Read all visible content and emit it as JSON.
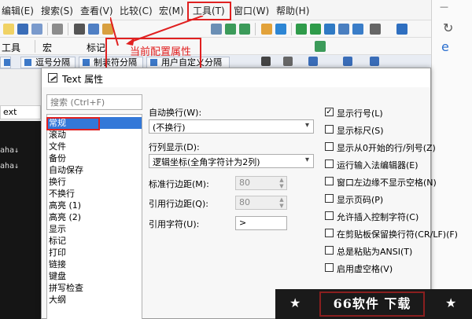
{
  "menu": {
    "items": [
      "编辑(E)",
      "搜索(S)",
      "查看(V)",
      "比较(C)",
      "宏(M)",
      "工具(T)",
      "窗口(W)",
      "帮助(H)"
    ],
    "highlighted": "工具(T)"
  },
  "toolbar2": {
    "tools_label": "工具",
    "macro_label": "宏",
    "mark_label": "标记"
  },
  "tabs": [
    "逗号分隔",
    "制表符分隔",
    "用户自定义分隔"
  ],
  "left_panel": {
    "tab_label": "ext",
    "lines": [
      "aha↓",
      "aha↓"
    ]
  },
  "annotation": {
    "label": "当前配置属性",
    "color": "#e02020"
  },
  "dialog": {
    "title": "Text 属性",
    "search_placeholder": "搜索 (Ctrl+F)",
    "categories": [
      "常规",
      "滚动",
      "文件",
      "备份",
      "自动保存",
      "换行",
      "不换行",
      "高亮 (1)",
      "高亮 (2)",
      "显示",
      "标记",
      "打印",
      "链接",
      "键盘",
      "拼写检查",
      "大纲"
    ],
    "selected_category": "常规",
    "auto_wrap": {
      "label": "自动换行(W):",
      "value": "(不换行)"
    },
    "column_display": {
      "label": "行列显示(D):",
      "value": "逻辑坐标(全角字符计为2列)"
    },
    "std_margin": {
      "label": "标准行边距(M):",
      "value": "80"
    },
    "quote_margin": {
      "label": "引用行边距(Q):",
      "value": "80"
    },
    "quote_char": {
      "label": "引用字符(U):",
      "value": ">"
    },
    "checkboxes": [
      {
        "label": "显示行号(L)",
        "checked": true
      },
      {
        "label": "显示标尺(S)",
        "checked": false
      },
      {
        "label": "显示从0开始的行/列号(Z)",
        "checked": false
      },
      {
        "label": "运行输入法编辑器(E)",
        "checked": false
      },
      {
        "label": "窗口左边缘不显示空格(N)",
        "checked": false
      },
      {
        "label": "显示页码(P)",
        "checked": false
      },
      {
        "label": "允许插入控制字符(C)",
        "checked": false
      },
      {
        "label": "在剪贴板保留换行符(CR/LF)(F)",
        "checked": false
      },
      {
        "label": "总是粘贴为ANSI(T)",
        "checked": false
      },
      {
        "label": "启用虚空格(V)",
        "checked": false
      }
    ]
  },
  "watermark": {
    "text": "66软件 下载"
  },
  "colors": {
    "accent": "#3378d8",
    "annotation": "#e02020"
  }
}
